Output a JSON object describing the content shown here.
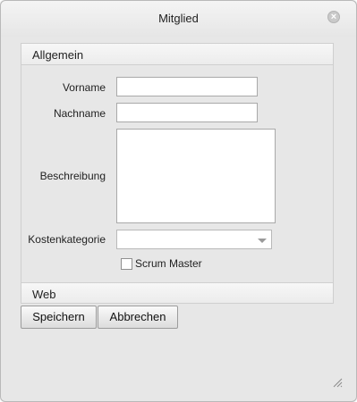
{
  "dialog": {
    "title": "Mitglied",
    "close_icon": "close-icon"
  },
  "sections": {
    "general": "Allgemein",
    "web": "Web"
  },
  "form": {
    "vorname_label": "Vorname",
    "vorname_value": "",
    "nachname_label": "Nachname",
    "nachname_value": "",
    "beschreibung_label": "Beschreibung",
    "beschreibung_value": "",
    "kostenkategorie_label": "Kostenkategorie",
    "kostenkategorie_value": "",
    "scrum_master_label": "Scrum Master",
    "scrum_master_checked": false
  },
  "buttons": {
    "save": "Speichern",
    "cancel": "Abbrechen"
  },
  "icons": {
    "resize": "resize-grip-icon",
    "dropdown": "chevron-down-icon"
  }
}
